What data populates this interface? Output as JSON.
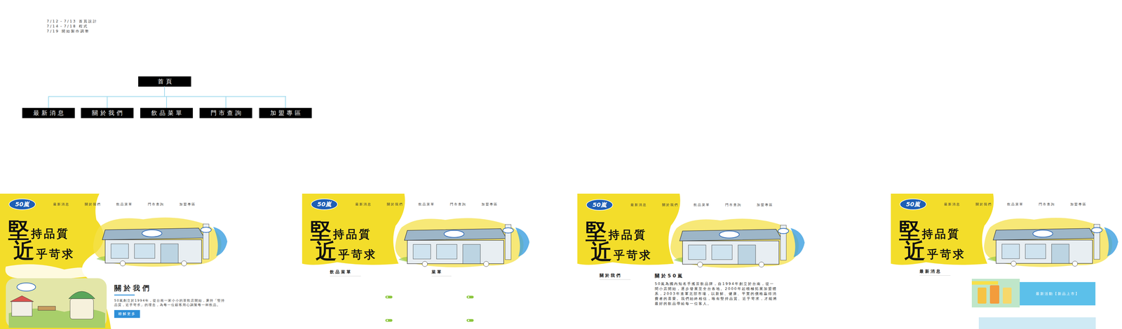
{
  "schedule": [
    "7/12－7/13 首頁設計",
    "7/14－7/18 程式",
    "7/19 開始製作調整"
  ],
  "sitemap": {
    "root": "首頁",
    "children": [
      "最新消息",
      "關於我們",
      "飲品菜單",
      "門市查詢",
      "加盟專區"
    ]
  },
  "mockups": [
    {
      "kind": "home",
      "logo": "50嵐",
      "nav": [
        "最新消息",
        "關於我們",
        "飲品菜單",
        "門市查詢",
        "加盟專區"
      ],
      "hero": [
        "堅持品質",
        "近乎苛求"
      ],
      "section": {
        "title": "關於我們",
        "text": "50嵐創立於1994年，從台南一家小小的茶飲店開始，秉持「堅持品質，近乎苛求」的理念，為每一位顧客用心調製每一杯飲品。",
        "button": "瞭解更多"
      }
    },
    {
      "kind": "menu",
      "logo": "50嵐",
      "nav": [
        "最新消息",
        "關於我們",
        "飲品菜單",
        "門市查詢",
        "加盟專區"
      ],
      "hero": [
        "堅持品質",
        "近乎苛求"
      ],
      "section": {
        "titles": [
          "飲品菜單",
          "菜單"
        ]
      }
    },
    {
      "kind": "about",
      "logo": "50嵐",
      "nav": [
        "最新消息",
        "關於我們",
        "飲品菜單",
        "門市查詢",
        "加盟專區"
      ],
      "hero": [
        "堅持品質",
        "近乎苛求"
      ],
      "section": {
        "side_title": "關於我們",
        "title": "關於50嵐",
        "text": "50嵐為國內知名手搖茶飲品牌，自1994年創立於台南，從一間小店開始，逐步發展至全台各地。2000年起積極拓展加盟體系，2003年進軍北部市場，以新鮮、健康、平實的價格贏得消費者的喜愛。我們始終相信，唯有堅持品質、近乎苛求，才能將最好的飲品帶給每一位客人。"
      }
    },
    {
      "kind": "news",
      "logo": "50嵐",
      "nav": [
        "最新消息",
        "關於我們",
        "飲品菜單",
        "門市查詢",
        "加盟專區"
      ],
      "hero": [
        "堅持品質",
        "近乎苛求"
      ],
      "section": {
        "title": "最新消息",
        "banners": [
          "最新活動【新品上市】"
        ]
      }
    }
  ]
}
